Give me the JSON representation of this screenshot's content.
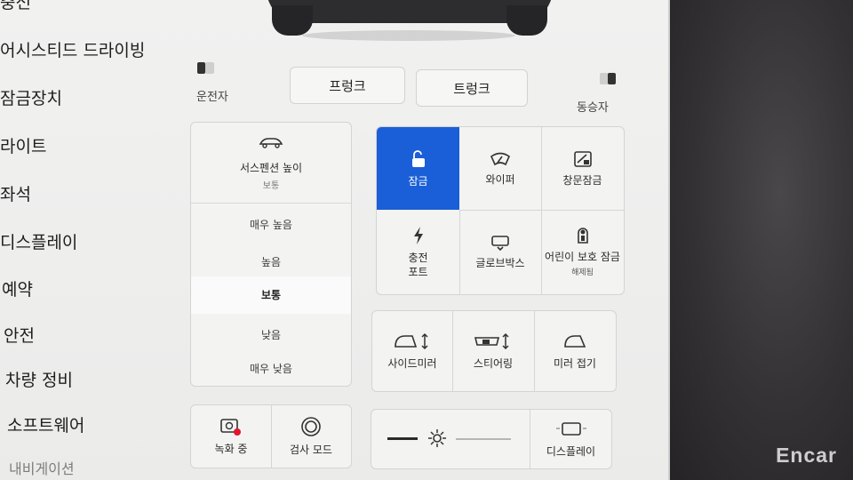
{
  "sidebar": {
    "items": [
      {
        "label": "충전"
      },
      {
        "label": "어시스티드 드라이빙"
      },
      {
        "label": "잠금장치"
      },
      {
        "label": "라이트"
      },
      {
        "label": "좌석"
      },
      {
        "label": "디스플레이"
      },
      {
        "label": "예약"
      },
      {
        "label": "안전"
      },
      {
        "label": "차량 정비"
      },
      {
        "label": "소프트웨어"
      },
      {
        "label": "내비게이션"
      }
    ]
  },
  "trunk": {
    "driver_label": "운전자",
    "passenger_label": "동승자",
    "frunk_label": "프렁크",
    "trunk_label": "트렁크"
  },
  "suspension": {
    "title": "서스펜션 높이",
    "current": "보통",
    "options": [
      "매우 높음",
      "높음",
      "보통",
      "낮음",
      "매우 낮음"
    ],
    "selected": "보통"
  },
  "controls": {
    "lock": "잠금",
    "wiper": "와이퍼",
    "window_lock": "창문잠금",
    "charge_port_l1": "충전",
    "charge_port_l2": "포트",
    "glovebox": "글로브박스",
    "child_lock": "어린이 보호 잠금",
    "child_lock_status": "해제됨"
  },
  "mirrors": {
    "side_mirror": "사이드미러",
    "steering": "스티어링",
    "fold": "미러 접기"
  },
  "bottom_left": {
    "dashcam": "녹화 중",
    "inspection": "검사 모드"
  },
  "bottom_right": {
    "display": "디스플레이"
  },
  "watermark": "Encar",
  "colors": {
    "accent": "#1a5fd8",
    "recording": "#e0182b"
  }
}
